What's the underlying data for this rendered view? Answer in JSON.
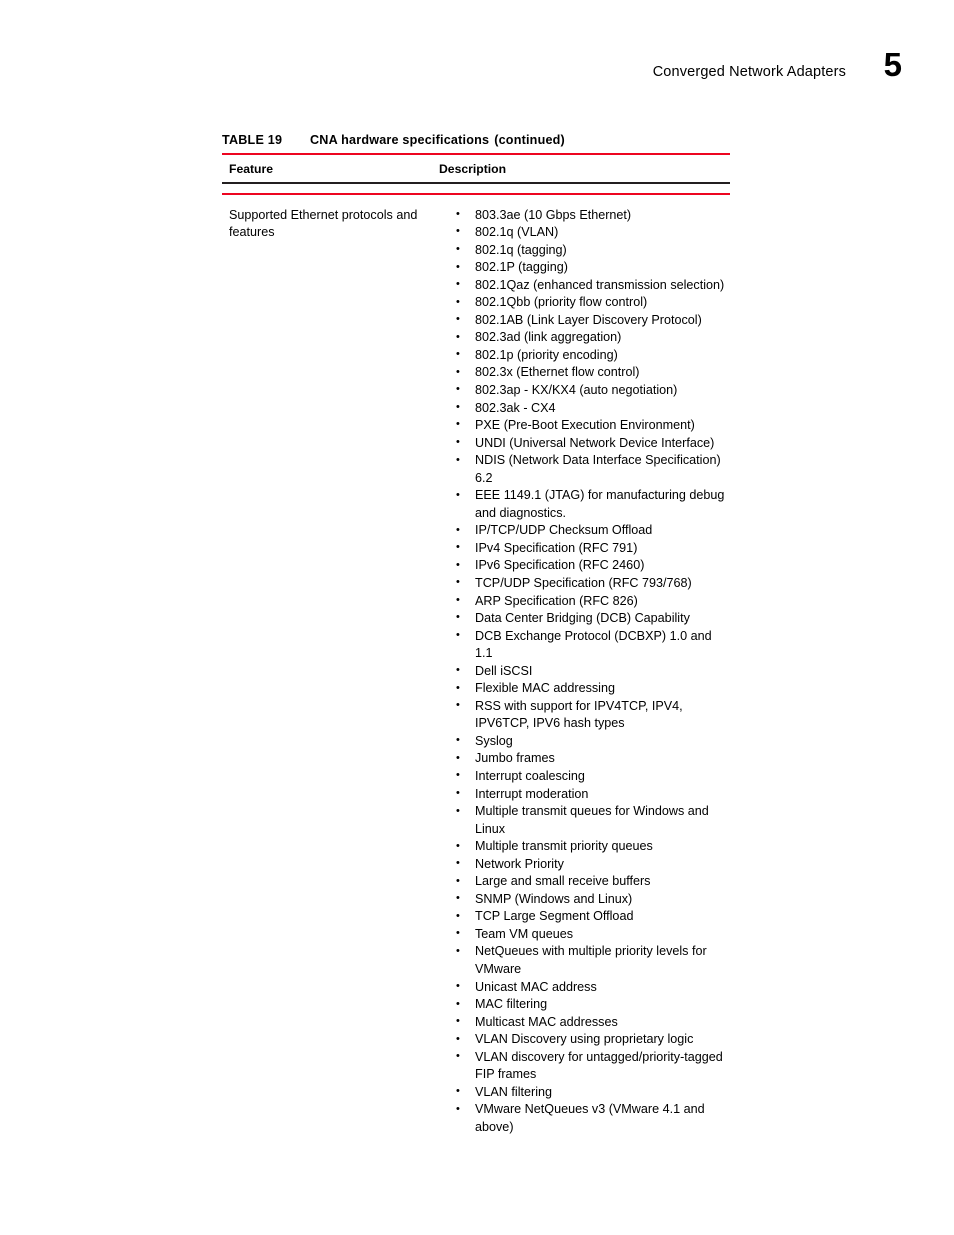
{
  "header": {
    "title": "Converged Network Adapters",
    "chapter_number": "5"
  },
  "table": {
    "caption_label": "TABLE 19",
    "caption_title": "CNA hardware specifications",
    "caption_continued": "(continued)",
    "columns": [
      "Feature",
      "Description"
    ],
    "row": {
      "feature": "Supported Ethernet protocols and features",
      "description": [
        "803.3ae (10 Gbps Ethernet)",
        "802.1q (VLAN)",
        "802.1q (tagging)",
        "802.1P (tagging)",
        "802.1Qaz (enhanced transmission selection)",
        "802.1Qbb (priority flow control)",
        "802.1AB (Link Layer Discovery Protocol)",
        "802.3ad (link aggregation)",
        "802.1p (priority encoding)",
        "802.3x (Ethernet flow control)",
        "802.3ap - KX/KX4 (auto negotiation)",
        "802.3ak - CX4",
        "PXE (Pre-Boot Execution Environment)",
        "UNDI (Universal Network Device Interface)",
        "NDIS (Network Data Interface Specification) 6.2",
        "EEE 1149.1 (JTAG) for manufacturing debug and diagnostics.",
        "IP/TCP/UDP Checksum Offload",
        "IPv4 Specification (RFC 791)",
        "IPv6 Specification (RFC 2460)",
        "TCP/UDP Specification (RFC 793/768)",
        "ARP Specification (RFC 826)",
        "Data Center Bridging (DCB) Capability",
        "DCB Exchange Protocol (DCBXP) 1.0 and 1.1",
        "Dell iSCSI",
        "Flexible MAC addressing",
        "RSS with support for IPV4TCP, IPV4, IPV6TCP, IPV6 hash types",
        "Syslog",
        "Jumbo frames",
        "Interrupt coalescing",
        "Interrupt moderation",
        "Multiple transmit queues for Windows and Linux",
        "Multiple transmit priority queues",
        "Network Priority",
        "Large and small receive buffers",
        "SNMP (Windows and Linux)",
        "TCP Large Segment Offload",
        "Team VM queues",
        "NetQueues with multiple priority levels for VMware",
        "Unicast MAC address",
        "MAC filtering",
        "Multicast MAC addresses",
        "VLAN Discovery using proprietary logic",
        "VLAN discovery for untagged/priority-tagged FIP frames",
        "VLAN filtering",
        "VMware NetQueues v3 (VMware 4.1 and above)"
      ]
    }
  },
  "colors": {
    "rule_red": "#ED0520",
    "rule_dark": "#231f20",
    "text": "#000000"
  }
}
